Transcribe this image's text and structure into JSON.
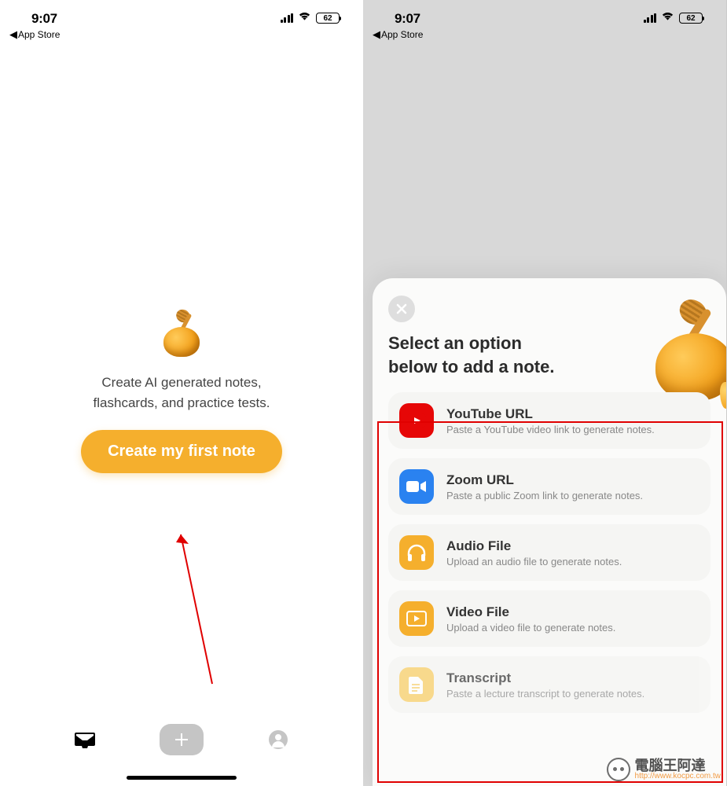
{
  "status": {
    "time": "9:07",
    "battery": "62",
    "breadcrumb_label": "App Store"
  },
  "left": {
    "onboard_line1": "Create AI generated notes,",
    "onboard_line2": "flashcards, and practice tests.",
    "cta_label": "Create my first note"
  },
  "right": {
    "modal_title_line1": "Select an option",
    "modal_title_line2": "below to add a note.",
    "options": [
      {
        "title": "YouTube URL",
        "desc": "Paste a YouTube video link to generate notes."
      },
      {
        "title": "Zoom URL",
        "desc": "Paste a public Zoom link to generate notes."
      },
      {
        "title": "Audio File",
        "desc": "Upload an audio file to generate notes."
      },
      {
        "title": "Video File",
        "desc": "Upload a video file to generate notes."
      },
      {
        "title": "Transcript",
        "desc": "Paste a lecture transcript to generate notes."
      }
    ]
  },
  "watermark": {
    "text": "電腦王阿達",
    "url": "http://www.kocpc.com.tw"
  }
}
